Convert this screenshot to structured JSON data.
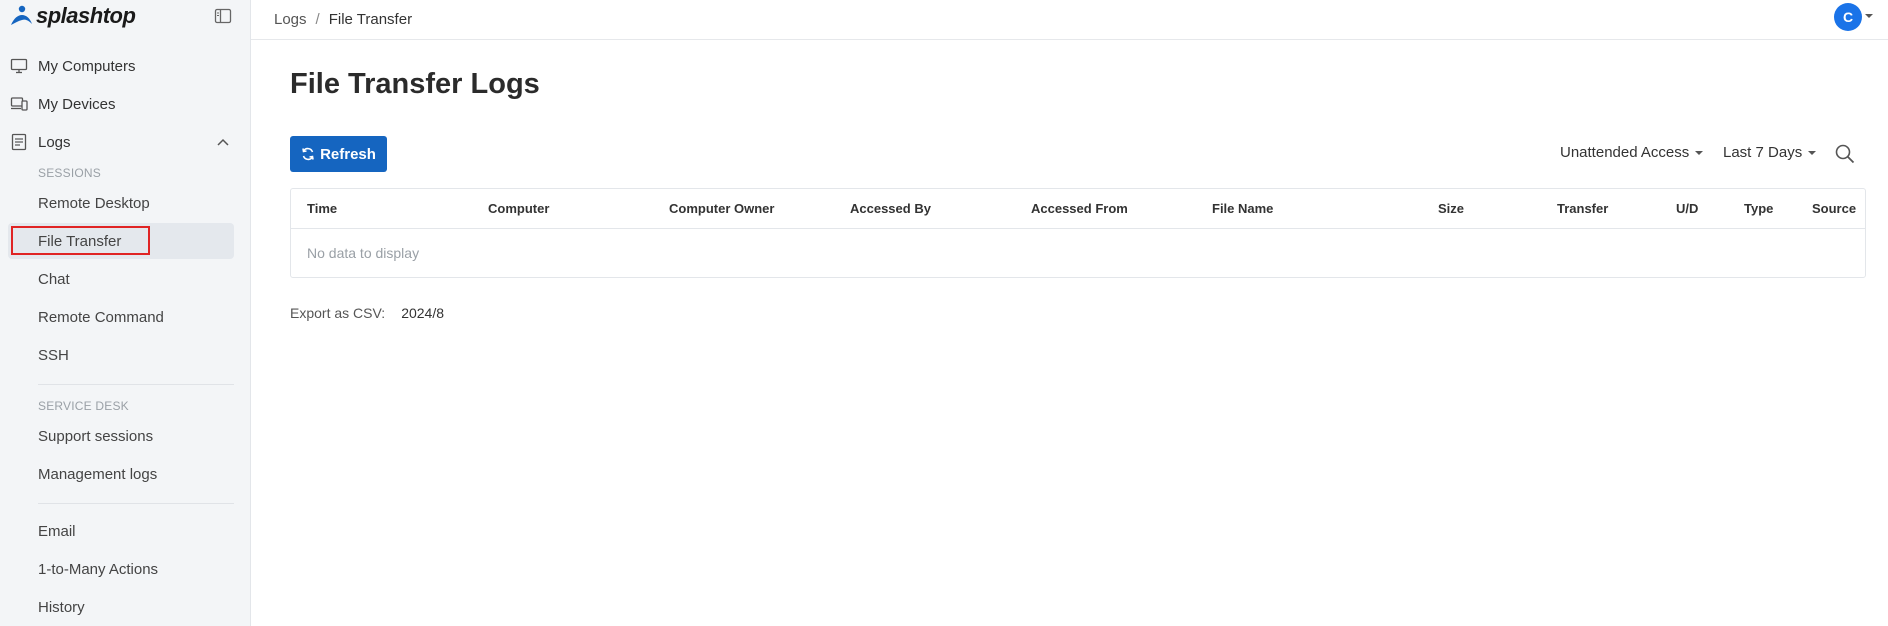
{
  "brand": {
    "name": "splashtop"
  },
  "sidebar": {
    "my_computers": "My Computers",
    "my_devices": "My Devices",
    "logs": "Logs",
    "sessions_label": "SESSIONS",
    "sessions": [
      "Remote Desktop",
      "File Transfer",
      "Chat",
      "Remote Command",
      "SSH"
    ],
    "service_desk_label": "SERVICE DESK",
    "service_desk": [
      "Support sessions",
      "Management logs"
    ],
    "other": [
      "Email",
      "1-to-Many Actions",
      "History"
    ]
  },
  "breadcrumb": {
    "parent": "Logs",
    "separator": "/",
    "current": "File Transfer"
  },
  "user": {
    "initial": "C"
  },
  "page": {
    "title": "File Transfer Logs"
  },
  "toolbar": {
    "refresh_label": "Refresh",
    "access_filter": "Unattended Access",
    "date_filter": "Last 7 Days"
  },
  "table": {
    "columns": [
      "Time",
      "Computer",
      "Computer Owner",
      "Accessed By",
      "Accessed From",
      "File Name",
      "Size",
      "Transfer",
      "U/D",
      "Type",
      "Source"
    ],
    "empty_text": "No data to display"
  },
  "export": {
    "label": "Export as CSV:",
    "link": "2024/8"
  },
  "colors": {
    "primary": "#1565c0",
    "avatar": "#1a73e8",
    "highlight": "#e02424"
  }
}
